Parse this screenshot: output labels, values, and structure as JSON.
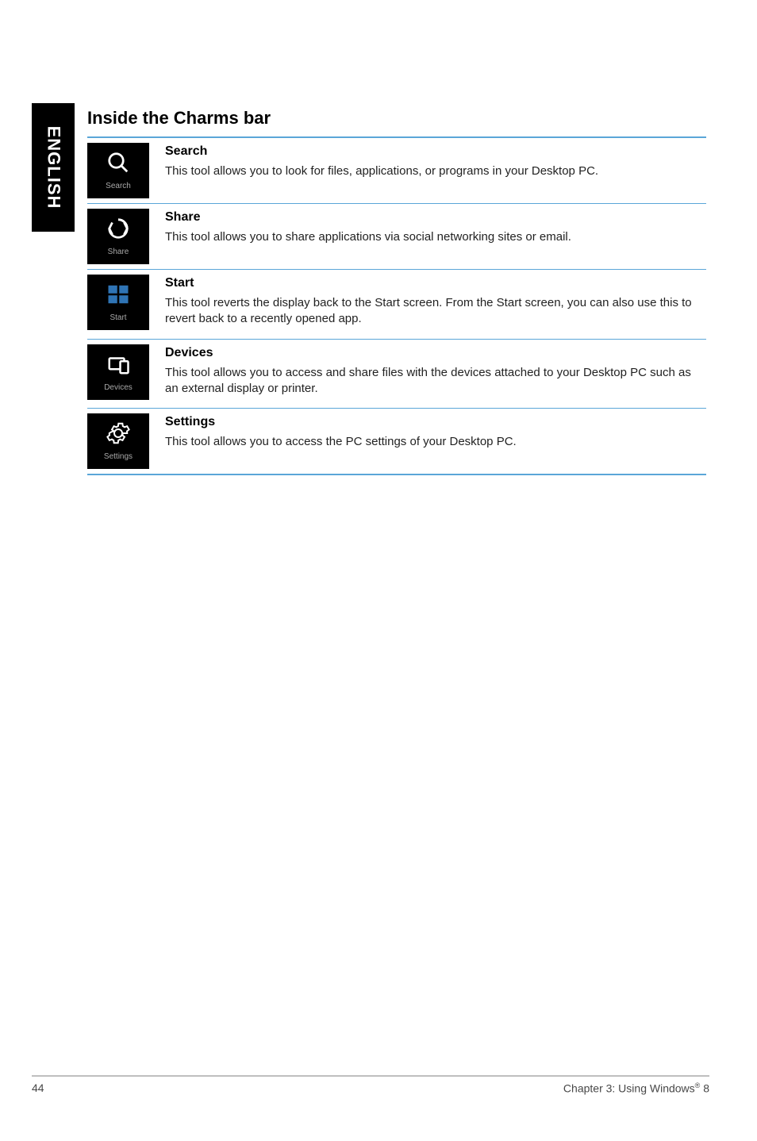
{
  "sideTab": "ENGLISH",
  "sectionTitle": "Inside the Charms bar",
  "charms": [
    {
      "label": "Search",
      "title": "Search",
      "text": "This tool allows you to look for files, applications, or programs in your Desktop PC."
    },
    {
      "label": "Share",
      "title": "Share",
      "text": "This tool allows you to share applications via social networking sites or email."
    },
    {
      "label": "Start",
      "title": "Start",
      "text": "This tool reverts the display back to the Start screen. From the Start screen, you can also use this to revert back to a recently opened app."
    },
    {
      "label": "Devices",
      "title": "Devices",
      "text": "This tool allows you to access and share files with the devices attached to your Desktop PC such as an external display or printer."
    },
    {
      "label": "Settings",
      "title": "Settings",
      "text": "This tool allows you to access the PC settings of your Desktop PC."
    }
  ],
  "footer": {
    "pageNumber": "44",
    "chapter": "Chapter 3: Using Windows",
    "chapterSup": "®",
    "chapterTail": " 8"
  }
}
